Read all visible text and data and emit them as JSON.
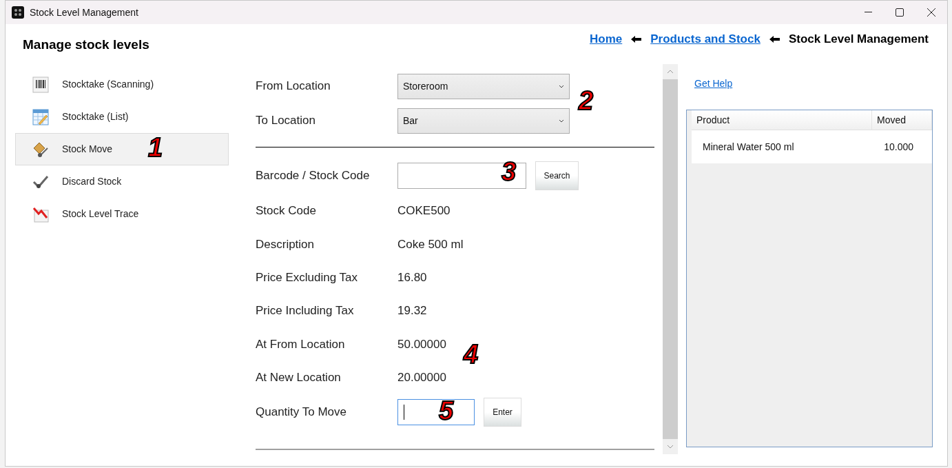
{
  "window": {
    "title": "Stock Level Management"
  },
  "page": {
    "heading": "Manage stock levels"
  },
  "breadcrumb": [
    {
      "label": "Home",
      "kind": "link"
    },
    {
      "label": "Products and Stock",
      "kind": "link"
    },
    {
      "label": "Stock Level Management",
      "kind": "current"
    }
  ],
  "sidebar": {
    "items": [
      {
        "label": "Stocktake (Scanning)",
        "kind": "barcode",
        "selected": false
      },
      {
        "label": "Stocktake (List)",
        "kind": "sheet",
        "selected": false
      },
      {
        "label": "Stock Move",
        "kind": "trolley",
        "selected": true
      },
      {
        "label": "Discard Stock",
        "kind": "tick",
        "selected": false
      },
      {
        "label": "Stock Level Trace",
        "kind": "trace",
        "selected": false
      }
    ]
  },
  "locations": [
    {
      "label": "From Location",
      "value": "Storeroom"
    },
    {
      "label": "To Location",
      "value": "Bar"
    }
  ],
  "lookup": {
    "label": "Barcode / Stock Code",
    "button": "Search"
  },
  "details": [
    {
      "label": "Stock Code",
      "value": "COKE500"
    },
    {
      "label": "Description",
      "value": "Coke 500 ml"
    },
    {
      "label": "Price Excluding Tax",
      "value": "16.80"
    },
    {
      "label": "Price Including Tax",
      "value": "19.32"
    },
    {
      "label": "At From Location",
      "value": "50.00000"
    },
    {
      "label": "At New Location",
      "value": "20.00000"
    }
  ],
  "quantity": {
    "label": "Quantity To Move",
    "focused": true,
    "button": "Enter"
  },
  "help_link": "Get Help",
  "table": {
    "columns": [
      "Product",
      "Moved"
    ],
    "rows": [
      [
        "Mineral Water 500 ml",
        "10.000"
      ]
    ]
  },
  "callouts": [
    "1",
    "2",
    "3",
    "4",
    "5"
  ]
}
